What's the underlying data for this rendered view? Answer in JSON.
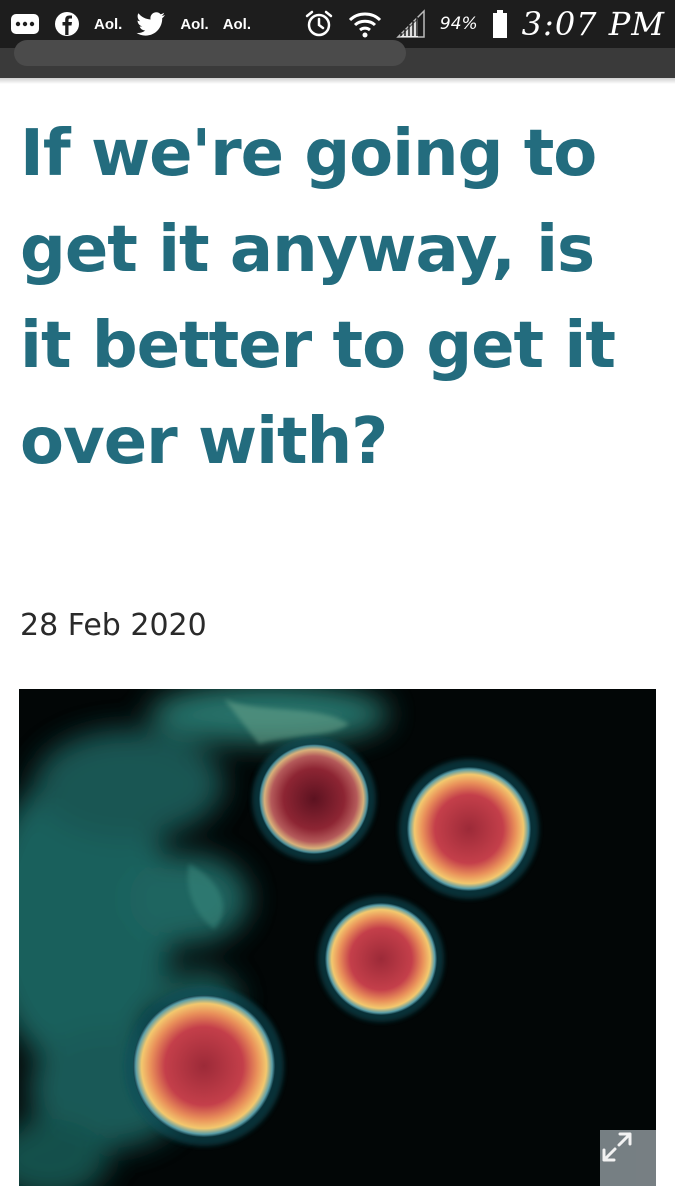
{
  "status_bar": {
    "notification_icons": [
      "more-icon",
      "facebook-icon",
      "aol-icon",
      "twitter-icon",
      "aol-icon",
      "aol-icon"
    ],
    "aol_labels": [
      "Aol.",
      "Aol.",
      "Aol."
    ],
    "battery_percent": "94%",
    "time": "3:07 PM"
  },
  "article": {
    "headline": "If we're going to get it anyway, is it better to get it over with?",
    "date": "28 Feb 2020",
    "image_subject": "virus-micrograph",
    "expand_icon": "expand-icon"
  },
  "colors": {
    "headline": "#236c7e",
    "status_bar_bg": "#1d1d1d",
    "browser_bar_bg": "#3a3a3a",
    "expand_button_bg": "#7d868a"
  }
}
